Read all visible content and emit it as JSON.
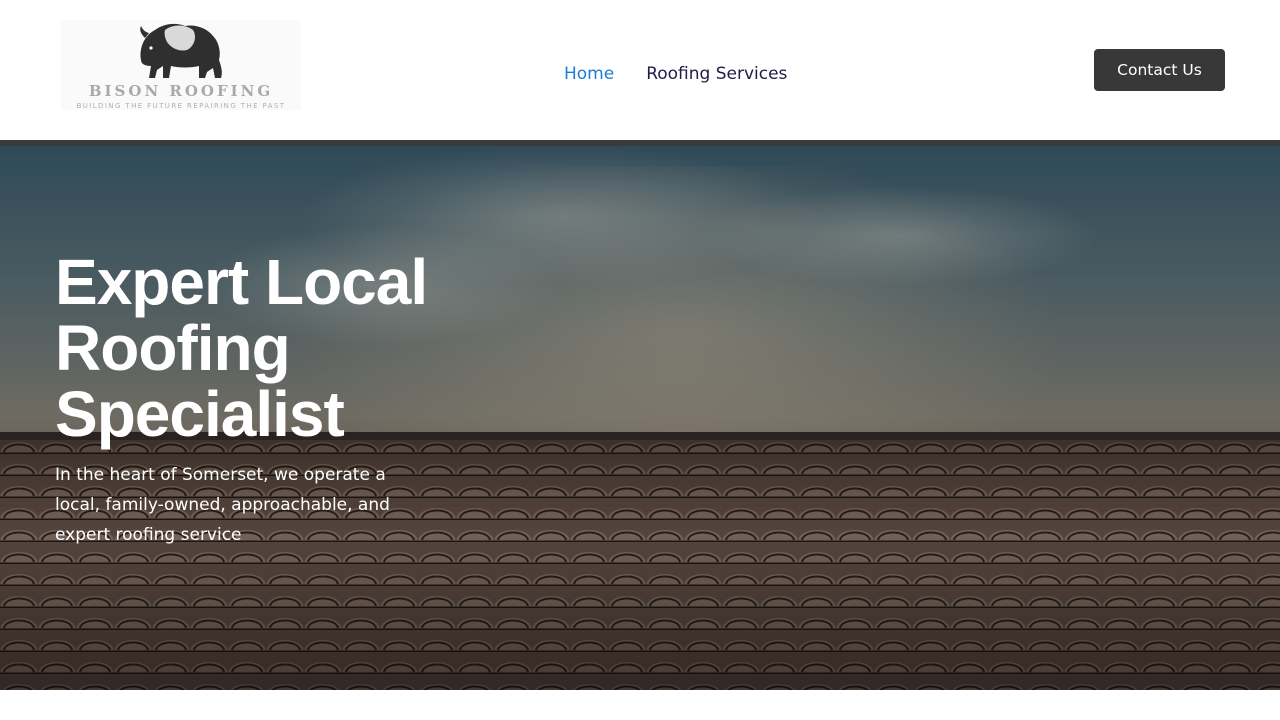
{
  "brand": {
    "name": "BISON ROOFING",
    "tagline": "BUILDING THE FUTURE REPAIRING THE PAST",
    "logo_icon": "bison-icon"
  },
  "nav": {
    "items": [
      {
        "label": "Home",
        "active": true
      },
      {
        "label": "Roofing Services",
        "active": false
      }
    ]
  },
  "header": {
    "contact_label": "Contact Us"
  },
  "hero": {
    "title": "Expert Local Roofing Specialist",
    "subtitle": "In the heart of Somerset, we operate a local, family-owned, approachable, and expert roofing service"
  },
  "colors": {
    "nav_active": "#1a7fd4",
    "nav_text": "#1f1d45",
    "button_bg": "#383838",
    "hero_text": "#ffffff"
  }
}
